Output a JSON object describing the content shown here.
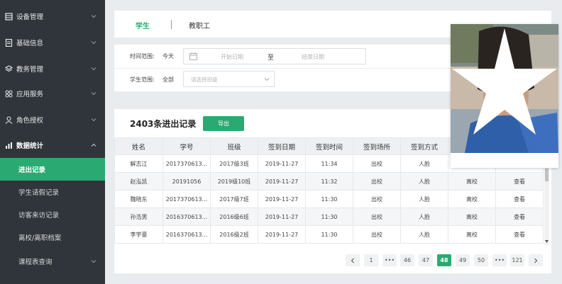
{
  "sidebar": {
    "menus": [
      {
        "label": "设备管理",
        "icon": "device-icon"
      },
      {
        "label": "基础信息",
        "icon": "document-icon"
      },
      {
        "label": "教务管理",
        "icon": "layers-icon"
      },
      {
        "label": "应用服务",
        "icon": "grid-icon"
      },
      {
        "label": "角色授权",
        "icon": "user-icon"
      },
      {
        "label": "数据统计",
        "icon": "chart-icon"
      }
    ],
    "submenus": [
      {
        "label": "进出记录",
        "active": true
      },
      {
        "label": "学生请假记录"
      },
      {
        "label": "访客来访记录"
      },
      {
        "label": "离校/离职档案"
      }
    ],
    "last_menu": {
      "label": "课程表查询"
    }
  },
  "tabs": {
    "student": "学生",
    "staff": "教职工"
  },
  "filters": {
    "time_label": "时间范围:",
    "time_value": "今天",
    "start_placeholder": "开始日期",
    "to": "至",
    "end_placeholder": "结束日期",
    "scope_label": "学生范围:",
    "scope_value": "全部",
    "class_placeholder": "请选择班级"
  },
  "records": {
    "title": "2403条进出记录",
    "export_label": "导出",
    "columns": [
      "姓名",
      "学号",
      "班级",
      "签到日期",
      "签到时间",
      "签到场所",
      "签到方式",
      "",
      ""
    ],
    "rows": [
      [
        "解志江",
        "2017370613...",
        "2017级3班",
        "2019-11-27",
        "11:34",
        "出校",
        "人脸",
        "",
        ""
      ],
      [
        "赵泓凯",
        "20191056",
        "2019级10班",
        "2019-11-27",
        "11:32",
        "出校",
        "人脸",
        "离校",
        "查看"
      ],
      [
        "魏晓东",
        "2017370613...",
        "2017级7班",
        "2019-11-27",
        "11:30",
        "出校",
        "人脸",
        "离校",
        "查看"
      ],
      [
        "孙浩男",
        "2016370613...",
        "2016级6班",
        "2019-11-27",
        "11:30",
        "出校",
        "人脸",
        "离校",
        "查看"
      ],
      [
        "李宇豪",
        "2016370613...",
        "2016级2班",
        "2019-11-27",
        "11:30",
        "出校",
        "人脸",
        "离校",
        "查看"
      ]
    ]
  },
  "pagination": {
    "prev": "<",
    "pages": [
      "1",
      "•••",
      "46",
      "47",
      "48",
      "49",
      "50",
      "•••",
      "121"
    ],
    "active": "48",
    "next": ">"
  },
  "colors": {
    "accent": "#2aaa72",
    "sidebar": "#2f353b"
  }
}
